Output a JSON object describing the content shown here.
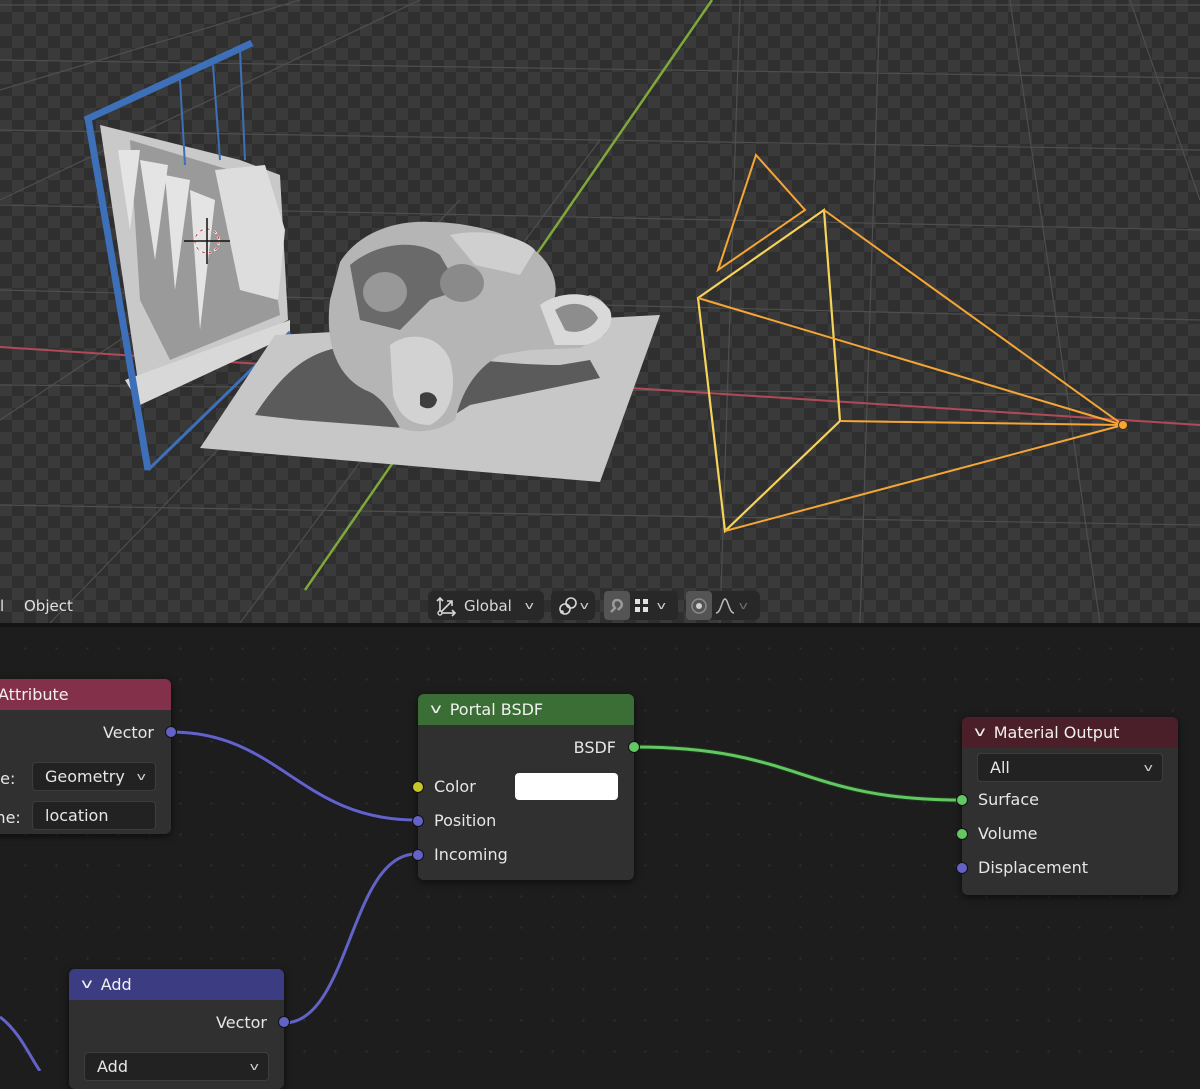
{
  "viewport": {
    "header": {
      "menu_partial": "l",
      "menu_object": "Object",
      "transform_orientation": "Global",
      "pivot_icon": "pivot-point-icon",
      "snap_icon": "snap-magnet-icon",
      "snap_target_icon": "snap-grid-icon",
      "proportional_icon": "proportional-editing-icon",
      "falloff_icon": "falloff-curve-icon"
    },
    "colors": {
      "x_axis": "#b04a58",
      "y_axis": "#7ea83c",
      "light_selected": "#f5a634",
      "light_active": "#f6d35b",
      "portal_plane": "#3d70b8"
    }
  },
  "nodes": {
    "attribute": {
      "title": "Attribute",
      "header_color": "#83314a",
      "output_vector": "Vector",
      "type_label": "pe:",
      "type_value": "Geometry",
      "name_label": "me:",
      "name_value": "location"
    },
    "portal_bsdf": {
      "title": "Portal BSDF",
      "header_color": "#3b6e34",
      "output_bsdf": "BSDF",
      "input_color": "Color",
      "color_value": "#ffffff",
      "input_position": "Position",
      "input_incoming": "Incoming"
    },
    "material_output": {
      "title": "Material Output",
      "header_color": "#4a1f2a",
      "target_value": "All",
      "input_surface": "Surface",
      "input_volume": "Volume",
      "input_displacement": "Displacement"
    },
    "add": {
      "title": "Add",
      "header_color": "#3c3c83",
      "output_vector": "Vector",
      "operation_value": "Add"
    }
  },
  "links": {
    "vector_color": "#6363c7",
    "shader_color": "#63c763"
  }
}
